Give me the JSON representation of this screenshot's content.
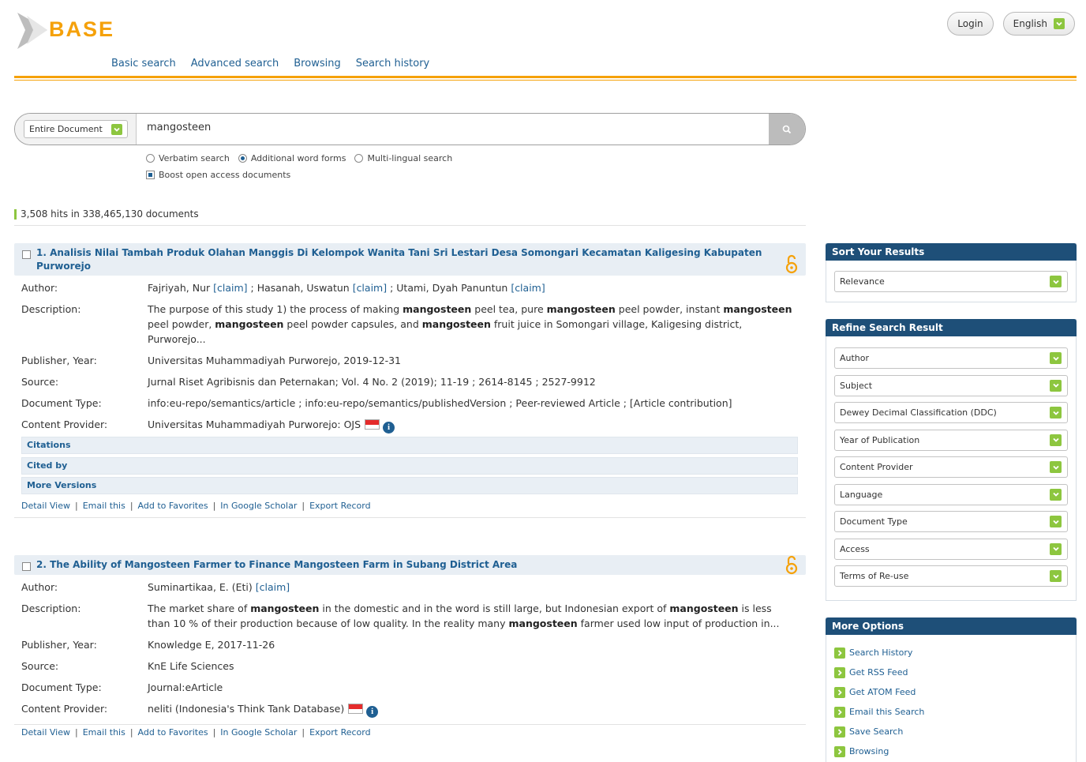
{
  "brand": {
    "logo_text": "BASE",
    "accent_color": "#f5a10a",
    "link_color": "#1f5f92",
    "green": "#8dc63f"
  },
  "top": {
    "login_label": "Login",
    "language_label": "English"
  },
  "nav": [
    "Basic search",
    "Advanced search",
    "Browsing",
    "Search history"
  ],
  "search": {
    "scope_label": "Entire Document",
    "query": "mangosteen",
    "options": {
      "verbatim": "Verbatim search",
      "additional": "Additional word forms",
      "multilingual": "Multi-lingual search",
      "boost": "Boost open access documents"
    }
  },
  "hits_text": "3,508 hits in 338,465,130 documents",
  "labels": {
    "author": "Author:",
    "description": "Description:",
    "publisher_year": "Publisher, Year:",
    "source": "Source:",
    "document_type": "Document Type:",
    "content_provider": "Content Provider:",
    "claim": "[claim]"
  },
  "results": [
    {
      "title": "1. Analisis Nilai Tambah Produk Olahan Manggis Di Kelompok Wanita Tani Sri Lestari Desa Somongari Kecamatan Kaligesing Kabupaten Purworejo",
      "authors": [
        "Fajriyah, Nur",
        "Hasanah, Uswatun",
        "Utami, Dyah Panuntun"
      ],
      "description_parts": [
        "The purpose of this study 1) the process of making ",
        "mangosteen",
        " peel tea, pure ",
        "mangosteen",
        " peel powder, instant ",
        "mangosteen",
        " peel powder, ",
        "mangosteen",
        " peel powder capsules, and ",
        "mangosteen",
        " fruit juice in Somongari village, Kaligesing district, Purworejo..."
      ],
      "publisher_year": "Universitas Muhammadiyah Purworejo, 2019-12-31",
      "source": "Jurnal Riset Agribisnis dan Peternakan; Vol. 4 No. 2 (2019); 11-19 ; 2614-8145 ; 2527-9912",
      "document_type": "info:eu-repo/semantics/article ; info:eu-repo/semantics/publishedVersion ; Peer-reviewed Article ; [Article contribution]",
      "content_provider": "Universitas Muhammadiyah Purworejo: OJS",
      "accordion": [
        "Citations",
        "Cited by",
        "More Versions"
      ]
    },
    {
      "title": "2. The Ability of Mangosteen Farmer to Finance Mangosteen Farm in Subang District Area",
      "authors": [
        "Suminartikaa, E. (Eti)"
      ],
      "description_parts": [
        "The market share of ",
        "mangosteen",
        " in the domestic and in the word is still large, but Indonesian export of ",
        "mangosteen",
        " is less than 10 % of their production because of low quality. In the reality many ",
        "mangosteen",
        " farmer used low input of production in..."
      ],
      "publisher_year": "Knowledge E, 2017-11-26",
      "source": "KnE Life Sciences",
      "document_type": "Journal:eArticle",
      "content_provider": "neliti (Indonesia's Think Tank Database)"
    }
  ],
  "actions": [
    "Detail View",
    "Email this",
    "Add to Favorites",
    "In Google Scholar",
    "Export Record"
  ],
  "sidebar": {
    "sort_title": "Sort Your Results",
    "sort_value": "Relevance",
    "refine_title": "Refine Search Result",
    "refine_items": [
      "Author",
      "Subject",
      "Dewey Decimal Classification (DDC)",
      "Year of Publication",
      "Content Provider",
      "Language",
      "Document Type",
      "Access",
      "Terms of Re-use"
    ],
    "more_title": "More Options",
    "more_items": [
      "Search History",
      "Get RSS Feed",
      "Get ATOM Feed",
      "Email this Search",
      "Save Search",
      "Browsing"
    ]
  }
}
